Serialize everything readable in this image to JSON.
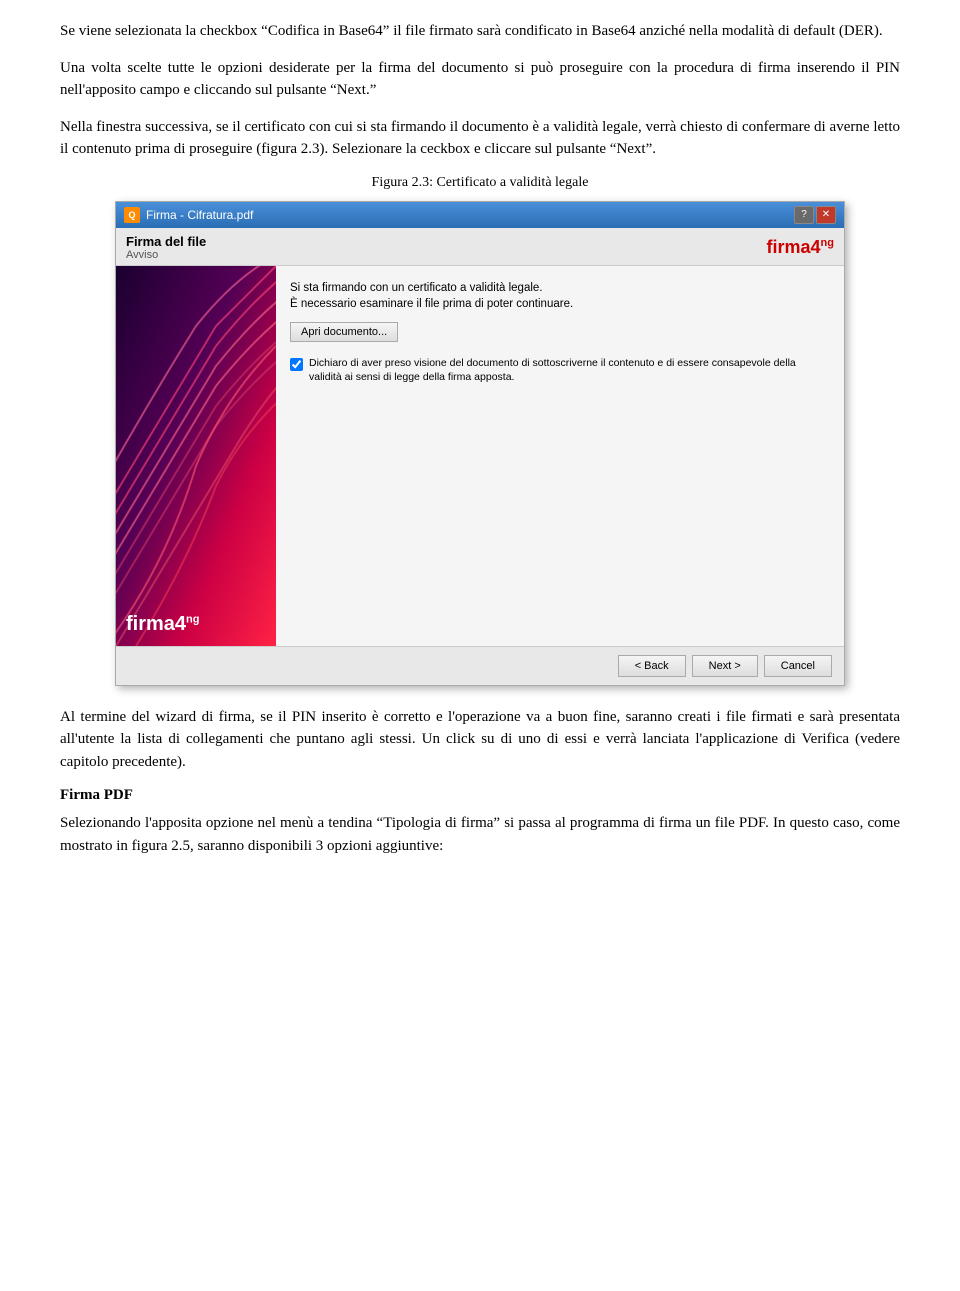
{
  "paragraphs": {
    "p1": "Se viene selezionata la checkbox “Codifica in Base64” il file firmato sarà condificato in Base64 anziché nella modalità di default (DER).",
    "p2": "Una volta scelte tutte le opzioni desiderate per la firma del documento si può proseguire con la procedura di firma inserendo il PIN nell'apposito campo e cliccando sul pulsante “Next.”",
    "p3": "Nella finestra successiva, se il certificato con cui si sta firmando il documento è a validità legale, verrà chiesto di confermare di averne letto il contenuto prima di proseguire (figura 2.3). Selezionare la ceckbox e cliccare sul pulsante “Next”.",
    "p4": "Al termine del wizard di firma, se il PIN inserito è corretto e l'operazione va a buon fine, saranno creati i file firmati e sarà presentata all'utente la lista di collegamenti che puntano agli stessi. Un click su di uno di essi e verrà lanciata l'applicazione di Verifica (vedere capitolo precedente).",
    "p5": "Selezionando l'apposita opzione nel menù a tendina “Tipologia di firma” si passa al programma di firma un file PDF. In questo caso, come mostrato in figura 2.5, saranno disponibili 3 opzioni aggiuntive:"
  },
  "figure": {
    "caption": "Figura 2.3: Certificato a validità legale",
    "titlebar": {
      "title": "Firma - Cifratura.pdf",
      "help_btn": "?",
      "close_btn": "✕"
    },
    "header": {
      "title": "Firma del file",
      "subtitle": "Avviso",
      "logo": "firma4"
    },
    "right_panel": {
      "message_line1": "Si sta firmando con un certificato a validità legale.",
      "message_line2": "È necessario esaminare il file prima di poter continuare.",
      "open_btn": "Apri documento...",
      "checkbox_label": "Dichiaro di aver preso visione del documento di sottoscriverne il contenuto e di essere consapevole della validità ai sensi di legge della firma apposta."
    },
    "left_panel_logo": "firma4",
    "footer": {
      "back_btn": "< Back",
      "next_btn": "Next >",
      "cancel_btn": "Cancel"
    }
  },
  "section_heading": "Firma PDF"
}
